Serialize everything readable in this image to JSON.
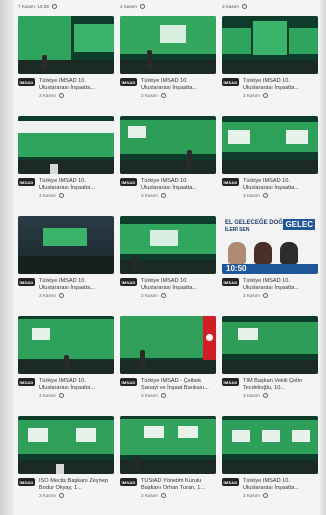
{
  "top_meta": [
    {
      "text": "7 Kasım, 15:38"
    },
    {
      "text": "4 Kasım"
    },
    {
      "text": "3 Kasım"
    }
  ],
  "cards": [
    {
      "title": "Türkiye İMSAD 10. Uluslararası İnşaatta...",
      "meta": "3 Kasım",
      "logo": "İMSAD"
    },
    {
      "title": "Türkiye İMSAD 10. Uluslararası İnşaatta...",
      "meta": "3 Kasım",
      "logo": "İMSAD"
    },
    {
      "title": "Türkiye İMSAD 10. Uluslararası İnşaatta...",
      "meta": "3 Kasım",
      "logo": "İMSAD"
    },
    {
      "title": "Türkiye İMSAD 10. Uluslararası İnşaatta...",
      "meta": "3 Kasım",
      "logo": "İMSAD"
    },
    {
      "title": "Türkiye İMSAD 10. Uluslararası İnşaatta...",
      "meta": "3 Kasım",
      "logo": "İMSAD"
    },
    {
      "title": "Türkiye İMSAD 10. Uluslararası İnşaatta...",
      "meta": "3 Kasım",
      "logo": "İMSAD"
    },
    {
      "title": "Türkiye İMSAD 10. Uluslararası İnşaatta...",
      "meta": "3 Kasım",
      "logo": "İMSAD"
    },
    {
      "title": "Türkiye İMSAD 10. Uluslararası İnşaatta...",
      "meta": "3 Kasım",
      "logo": "İMSAD"
    },
    {
      "title": "Türkiye İMSAD 10. Uluslararası İnşaatta...",
      "meta": "3 Kasım",
      "logo": "İMSAD",
      "news_head1": "EL GELECEĞE DOĞRU",
      "news_head2": "İLERİ SEN",
      "news_time": "10:50",
      "news_right": "GELEC"
    },
    {
      "title": "Türkiye İMSAD 10. Uluslararası İnşaatta...",
      "meta": "3 Kasım",
      "logo": "İMSAD"
    },
    {
      "title": "Türkiye İMSAD - Çelbek Sanayi ve İnşaat Bankası...",
      "meta": "3 Kasım",
      "logo": "İMSAD"
    },
    {
      "title": "TİM Başkan Vekili Çetin Tecdelioğlu, 10...",
      "meta": "3 Kasım",
      "logo": "İMSAD"
    },
    {
      "title": "İSO Meclis Başkanı Zeynep Bodur Okyay, 1...",
      "meta": "3 Kasım",
      "logo": "İMSAD"
    },
    {
      "title": "TÜSİAD Yönetim Kurulu Başkanı Orhan Turan, 1...",
      "meta": "3 Kasım",
      "logo": "İMSAD"
    },
    {
      "title": "Türkiye İMSAD 10. Uluslararası İnşaatta...",
      "meta": "3 Kasım",
      "logo": "İMSAD"
    }
  ]
}
